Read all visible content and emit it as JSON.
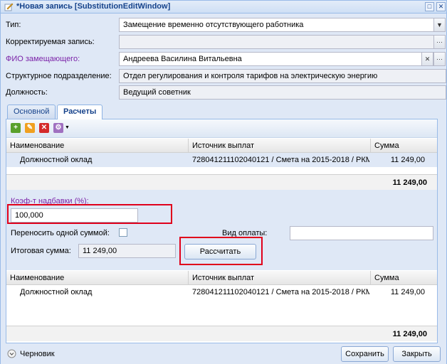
{
  "window": {
    "title": "*Новая запись [SubstitutionEditWindow]",
    "colors": {
      "title_text": "#15428b",
      "highlight": "#e0001b",
      "purple_label": "#7b22a8"
    }
  },
  "form": {
    "type_label": "Тип:",
    "type_value": "Замещение временно отсутствующего работника",
    "corrected_label": "Корректируемая запись:",
    "corrected_value": "",
    "fio_label": "ФИО замещающего:",
    "fio_value": "Андреева Василина Витальевна",
    "dept_label": "Структурное подразделение:",
    "dept_value": "Отдел регулирования и контроля тарифов на электрическую энергию",
    "position_label": "Должность:",
    "position_value": "Ведущий советник"
  },
  "tabs": [
    {
      "label": "Основной"
    },
    {
      "label": "Расчеты"
    }
  ],
  "grid_top": {
    "columns": [
      "Наименование",
      "Источник выплат",
      "Сумма"
    ],
    "rows": [
      {
        "name": "Должностной оклад",
        "source": "728041211102040121 / Смета на 2015-2018 / РКМ ...",
        "sum": "11 249,00"
      }
    ],
    "total": "11 249,00"
  },
  "calc": {
    "coef_label": "Коэф-т надбавки (%):",
    "coef_value": "100,000",
    "single_sum_label": "Переносить одной суммой:",
    "payment_type_label": "Вид оплаты:",
    "payment_type_value": "",
    "total_label": "Итоговая сумма:",
    "total_value": "11 249,00",
    "calc_button": "Рассчитать"
  },
  "grid_bottom": {
    "columns": [
      "Наименование",
      "Источник выплат",
      "Сумма"
    ],
    "rows": [
      {
        "name": "Должностной оклад",
        "source": "728041211102040121 / Смета на 2015-2018 / РКМ ...",
        "sum": "11 249,00"
      }
    ],
    "total": "11 249,00"
  },
  "footer": {
    "status": "Черновик",
    "save_button": "Сохранить",
    "close_button": "Закрыть"
  }
}
